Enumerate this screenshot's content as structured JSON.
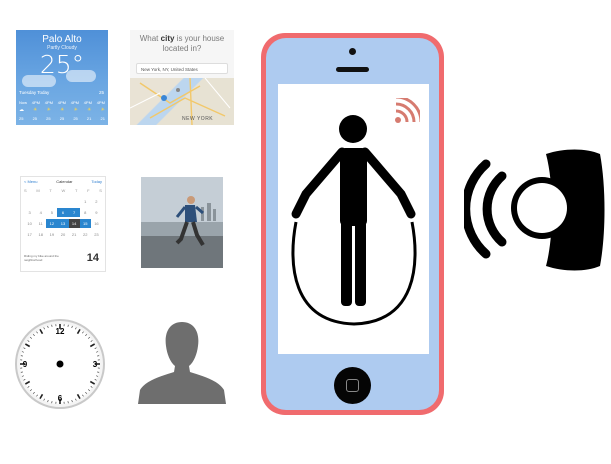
{
  "weather": {
    "city": "Palo Alto",
    "condition": "Partly Cloudy",
    "temperature": "25°",
    "day": "Tuesday  Today",
    "high": "25",
    "hours": [
      "Now",
      "4PM",
      "4PM",
      "4PM",
      "4PM",
      "4PM",
      "4PM"
    ],
    "icons": [
      "☁",
      "☀",
      "☀",
      "☀",
      "☀",
      "☀",
      "☀"
    ],
    "temps": [
      "25",
      "25",
      "25",
      "25",
      "25",
      "21",
      "21"
    ]
  },
  "city_prompt": {
    "question_prefix": "What",
    "question_bold": "city",
    "question_suffix": "is your house located in?",
    "input_value": "New York, NY, United States",
    "map_label": "NEW YORK"
  },
  "calendar": {
    "back": "< Menu",
    "title": "Calendar",
    "action": "Today",
    "weekdays": [
      "S",
      "M",
      "T",
      "W",
      "T",
      "F",
      "S"
    ],
    "days": [
      "",
      "",
      "",
      "",
      "",
      "1",
      "2",
      "3",
      "4",
      "5",
      "6",
      "7",
      "8",
      "9",
      "10",
      "11",
      "12",
      "13",
      "14",
      "15",
      "16",
      "17",
      "18",
      "19",
      "20",
      "21",
      "22",
      "23"
    ],
    "highlight_blue": [
      "6",
      "7",
      "12",
      "13",
      "15"
    ],
    "highlight_dark": [
      "14"
    ],
    "note": "Riding my bike around the neighborhood",
    "big_day": "14"
  },
  "clock": {
    "numbers": [
      "12",
      "3",
      "6",
      "9"
    ]
  },
  "colors": {
    "phone_body": "#f06b6e",
    "phone_face": "#aecbf0",
    "wifi_icon": "#d67b70",
    "icons": "#000000",
    "person_silhouette": "#6e6e6e"
  },
  "icons": {
    "phone_screen": "jump-rope-person-icon",
    "wifi": "wifi-signal-icon",
    "watch": "smartwatch-vibrate-icon",
    "person": "person-silhouette-icon",
    "clock": "clock-icon"
  }
}
